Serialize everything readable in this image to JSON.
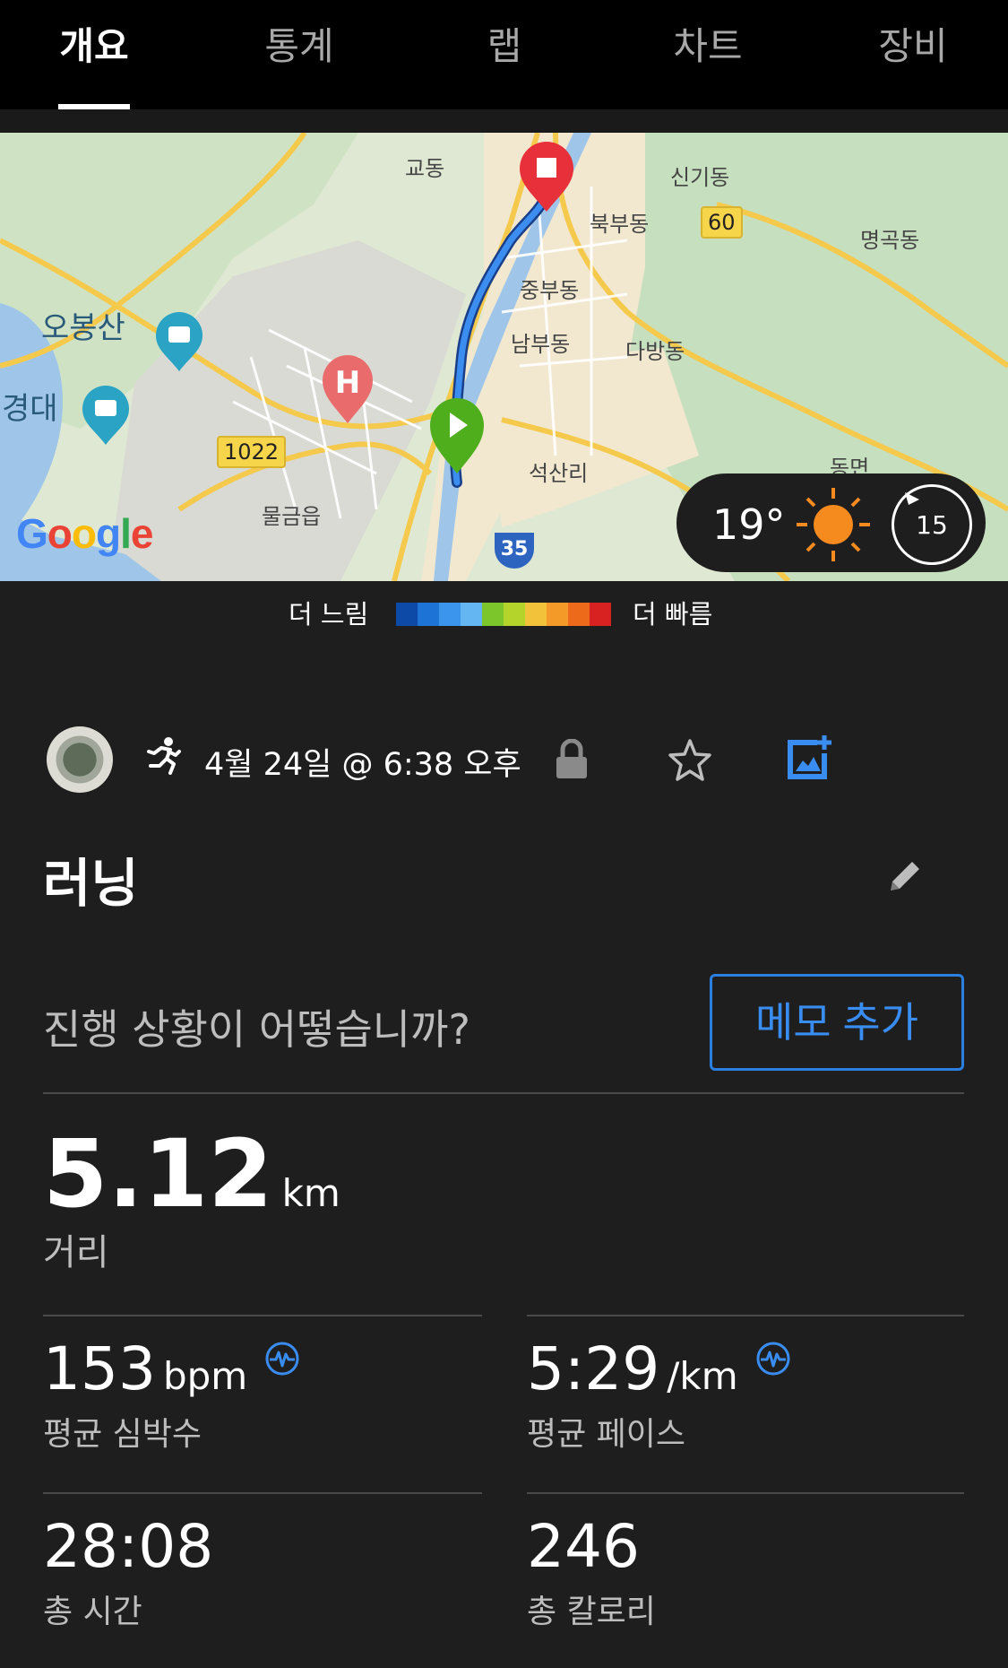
{
  "tabs": [
    {
      "label": "개요",
      "active": true
    },
    {
      "label": "통계",
      "active": false
    },
    {
      "label": "랩",
      "active": false
    },
    {
      "label": "차트",
      "active": false
    },
    {
      "label": "장비",
      "active": false
    }
  ],
  "map": {
    "labels": [
      "교동",
      "신기동",
      "북부동",
      "명곡동",
      "중부동",
      "남부동",
      "다방동",
      "오봉산",
      "경대",
      "석산리",
      "물금읍",
      "동면"
    ],
    "route_badges": [
      "60",
      "1022"
    ],
    "route_shield": "35",
    "attribution": "Google"
  },
  "weather": {
    "temp": "19°",
    "wind": "15",
    "icon": "sun-icon"
  },
  "legend": {
    "slow": "더 느림",
    "fast": "더 빠름",
    "colors": [
      "#0d4aa8",
      "#1e73d6",
      "#3c95ec",
      "#63b6f2",
      "#7cc62c",
      "#b4d42c",
      "#f2c23a",
      "#f39a28",
      "#ec6a1a",
      "#d82222"
    ]
  },
  "activity": {
    "date": "4월 24일 @ 6:38 오후",
    "title": "러닝",
    "question": "진행 상황이 어떻습니까?",
    "memo_button": "메모 추가"
  },
  "stats": {
    "distance": {
      "value": "5.12",
      "unit": "km",
      "label": "거리"
    },
    "avg_hr": {
      "value": "153",
      "unit": "bpm",
      "label": "평균 심박수"
    },
    "avg_pace": {
      "value": "5:29",
      "unit": "/km",
      "label": "평균 페이스"
    },
    "total_time": {
      "value": "28:08",
      "label": "총 시간"
    },
    "calories": {
      "value": "246",
      "label": "총 칼로리"
    }
  },
  "colors": {
    "accent": "#2a7fe0",
    "background": "#1e1e1e",
    "tab_bg": "#000000"
  }
}
